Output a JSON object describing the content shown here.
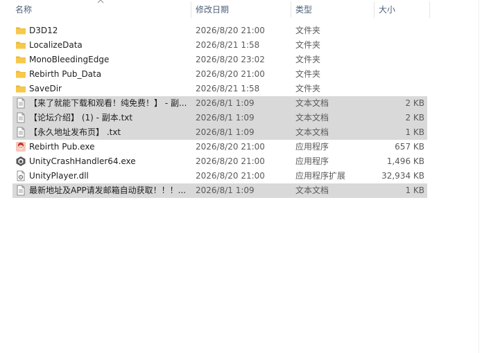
{
  "columns": {
    "name": "名称",
    "date": "修改日期",
    "type": "类型",
    "size": "大小"
  },
  "files": [
    {
      "name": "D3D12",
      "date": "2026/8/20 21:00",
      "type": "文件夹",
      "size": "",
      "icon": "folder-icon",
      "selected": false
    },
    {
      "name": "LocalizeData",
      "date": "2026/8/21 1:58",
      "type": "文件夹",
      "size": "",
      "icon": "folder-icon",
      "selected": false
    },
    {
      "name": "MonoBleedingEdge",
      "date": "2026/8/20 23:02",
      "type": "文件夹",
      "size": "",
      "icon": "folder-icon",
      "selected": false
    },
    {
      "name": "Rebirth Pub_Data",
      "date": "2026/8/20 21:00",
      "type": "文件夹",
      "size": "",
      "icon": "folder-icon",
      "selected": false
    },
    {
      "name": "SaveDir",
      "date": "2026/8/21 1:58",
      "type": "文件夹",
      "size": "",
      "icon": "folder-icon",
      "selected": false
    },
    {
      "name": "【来了就能下载和观看！纯免费！】 - 副...",
      "date": "2026/8/1 1:09",
      "type": "文本文档",
      "size": "2 KB",
      "icon": "text-file-icon",
      "selected": true
    },
    {
      "name": "【论坛介绍】 (1) - 副本.txt",
      "date": "2026/8/1 1:09",
      "type": "文本文档",
      "size": "2 KB",
      "icon": "text-file-icon",
      "selected": true
    },
    {
      "name": "【永久地址发布页】 .txt",
      "date": "2026/8/1 1:09",
      "type": "文本文档",
      "size": "1 KB",
      "icon": "text-file-icon",
      "selected": true
    },
    {
      "name": "Rebirth Pub.exe",
      "date": "2026/8/20 21:00",
      "type": "应用程序",
      "size": "657 KB",
      "icon": "game-app-icon",
      "selected": false
    },
    {
      "name": "UnityCrashHandler64.exe",
      "date": "2026/8/20 21:00",
      "type": "应用程序",
      "size": "1,496 KB",
      "icon": "unity-icon",
      "selected": false
    },
    {
      "name": "UnityPlayer.dll",
      "date": "2026/8/20 21:00",
      "type": "应用程序扩展",
      "size": "32,934 KB",
      "icon": "dll-icon",
      "selected": false
    },
    {
      "name": "最新地址及APP请发邮箱自动获取！！！...",
      "date": "2026/8/1 1:09",
      "type": "文本文档",
      "size": "1 KB",
      "icon": "text-file-icon",
      "selected": true
    }
  ],
  "colors": {
    "selection": "#d9d9d9",
    "folder": "#f7c84a",
    "header_text": "#4c607a"
  }
}
